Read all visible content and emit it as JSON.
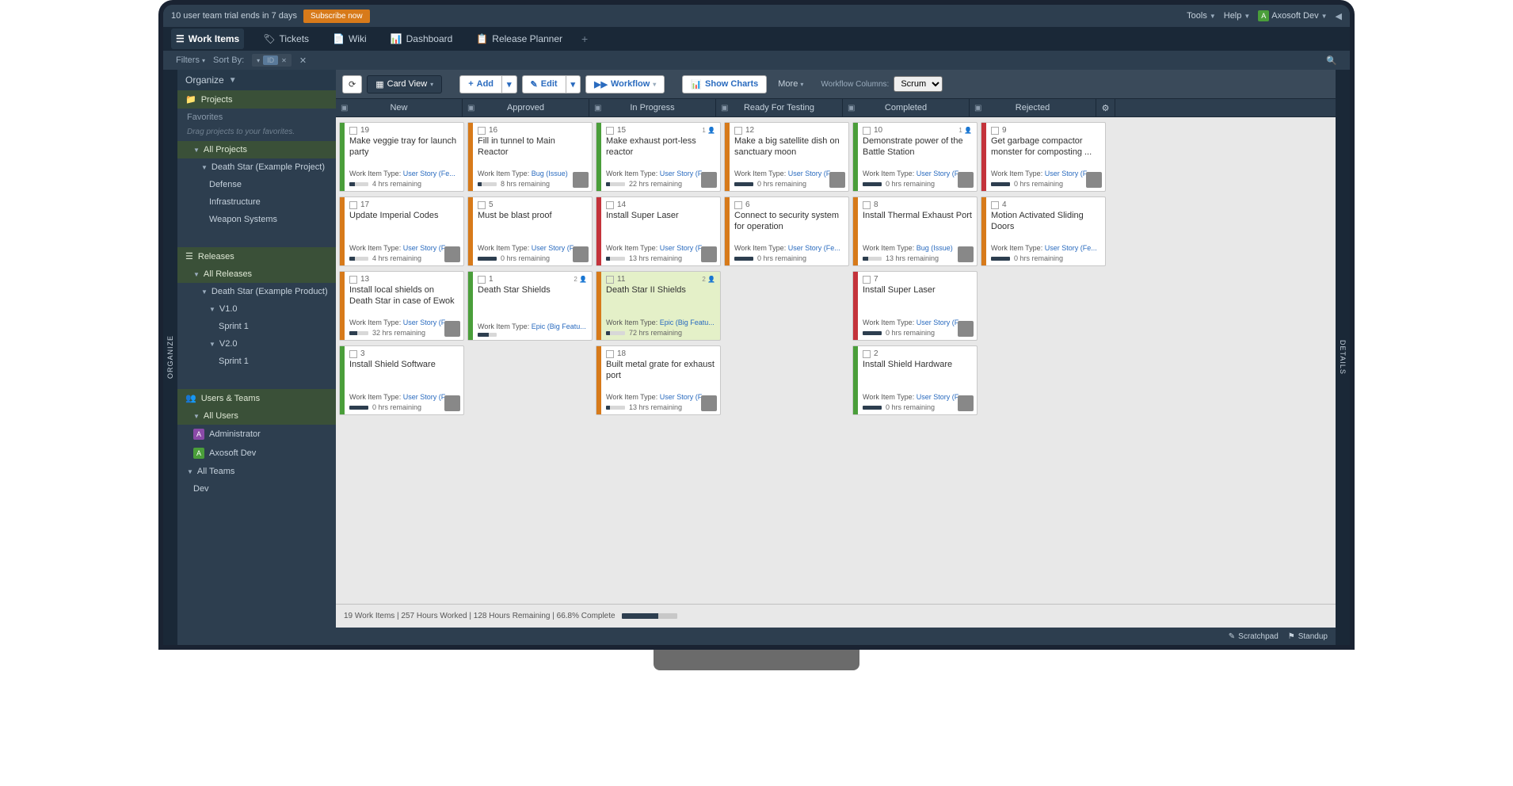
{
  "topbar": {
    "trial_msg": "10 user team trial ends in 7 days",
    "subscribe": "Subscribe now",
    "tools": "Tools",
    "help": "Help",
    "user": "Axosoft Dev",
    "user_initial": "A"
  },
  "tabs": {
    "work_items": "Work Items",
    "tickets": "Tickets",
    "wiki": "Wiki",
    "dashboard": "Dashboard",
    "release_planner": "Release Planner"
  },
  "filterbar": {
    "filters": "Filters",
    "sort_by": "Sort By:",
    "sort_chip": "ID"
  },
  "sidebar": {
    "organize": "Organize",
    "projects": "Projects",
    "favorites": "Favorites",
    "fav_hint": "Drag projects to your favorites.",
    "all_projects": "All Projects",
    "project_tree": {
      "name": "Death Star (Example Project)",
      "children": [
        "Defense",
        "Infrastructure",
        "Weapon Systems"
      ]
    },
    "releases": "Releases",
    "all_releases": "All Releases",
    "release_tree": {
      "name": "Death Star (Example Product)",
      "v1": "V1.0",
      "sprint1": "Sprint 1",
      "v2": "V2.0",
      "sprint1b": "Sprint 1"
    },
    "users_teams": "Users & Teams",
    "all_users": "All Users",
    "admin": "Administrator",
    "axdev": "Axosoft Dev",
    "all_teams": "All Teams",
    "dev": "Dev"
  },
  "toolbar": {
    "card_view": "Card View",
    "add": "Add",
    "edit": "Edit",
    "workflow": "Workflow",
    "show_charts": "Show Charts",
    "more": "More",
    "workflow_columns": "Workflow Columns:",
    "scrum": "Scrum"
  },
  "columns": [
    "New",
    "Approved",
    "In Progress",
    "Ready For Testing",
    "Completed",
    "Rejected"
  ],
  "cards": [
    [
      {
        "id": "19",
        "title": "Make veggie tray for launch party",
        "type": "User Story (Fe...",
        "remaining": "4 hrs remaining",
        "stripe": "green",
        "progress": 30
      },
      {
        "id": "17",
        "title": "Update Imperial Codes",
        "type": "User Story (Fe...",
        "remaining": "4 hrs remaining",
        "stripe": "orange",
        "progress": 30,
        "avatar": true
      },
      {
        "id": "13",
        "title": "Install local shields on Death Star in case of Ewok uprising",
        "type": "User Story (Fe...",
        "remaining": "32 hrs remaining",
        "stripe": "orange",
        "progress": 40,
        "avatar": true
      },
      {
        "id": "3",
        "title": "Install Shield Software",
        "type": "User Story (Fe...",
        "remaining": "0 hrs remaining",
        "stripe": "green",
        "progress": 100,
        "avatar": true
      }
    ],
    [
      {
        "id": "16",
        "title": "Fill in tunnel to Main Reactor",
        "type": "Bug (Issue)",
        "remaining": "8 hrs remaining",
        "stripe": "orange",
        "progress": 20,
        "avatar": true
      },
      {
        "id": "5",
        "title": "Must be blast proof",
        "type": "User Story (Fe...",
        "remaining": "0 hrs remaining",
        "stripe": "orange",
        "progress": 100,
        "avatar": true
      },
      {
        "id": "1",
        "title": "Death Star Shields",
        "type": "Epic (Big Featu...",
        "remaining": "",
        "stripe": "green",
        "progress": 60,
        "badge": "2"
      }
    ],
    [
      {
        "id": "15",
        "title": "Make exhaust port-less reactor",
        "type": "User Story (Fe...",
        "remaining": "22 hrs remaining",
        "stripe": "green",
        "progress": 20,
        "avatar": true,
        "badge": "1"
      },
      {
        "id": "14",
        "title": "Install Super Laser",
        "type": "User Story (Fe...",
        "remaining": "13 hrs remaining",
        "stripe": "red",
        "progress": 20,
        "avatar": true
      },
      {
        "id": "11",
        "title": "Death Star II Shields",
        "type": "Epic (Big Featu...",
        "remaining": "72 hrs remaining",
        "stripe": "orange",
        "progress": 20,
        "highlighted": true,
        "badge": "2"
      },
      {
        "id": "18",
        "title": "Built metal grate for exhaust port",
        "type": "User Story (Fe...",
        "remaining": "13 hrs remaining",
        "stripe": "orange",
        "progress": 20,
        "avatar": true
      }
    ],
    [
      {
        "id": "12",
        "title": "Make a big satellite dish on sanctuary moon",
        "type": "User Story (Fe...",
        "remaining": "0 hrs remaining",
        "stripe": "orange",
        "progress": 100,
        "avatar": true
      },
      {
        "id": "6",
        "title": "Connect to security system for operation",
        "type": "User Story (Fe...",
        "remaining": "0 hrs remaining",
        "stripe": "orange",
        "progress": 100
      }
    ],
    [
      {
        "id": "10",
        "title": "Demonstrate power of the Battle Station",
        "type": "User Story (Fe...",
        "remaining": "0 hrs remaining",
        "stripe": "green",
        "progress": 100,
        "avatar": true,
        "badge": "1"
      },
      {
        "id": "8",
        "title": "Install Thermal Exhaust Port",
        "type": "Bug (Issue)",
        "remaining": "13 hrs remaining",
        "stripe": "orange",
        "progress": 30,
        "avatar": true
      },
      {
        "id": "7",
        "title": "Install Super Laser",
        "type": "User Story (Fe...",
        "remaining": "0 hrs remaining",
        "stripe": "red",
        "progress": 100,
        "avatar": true
      },
      {
        "id": "2",
        "title": "Install Shield Hardware",
        "type": "User Story (Fe...",
        "remaining": "0 hrs remaining",
        "stripe": "green",
        "progress": 100,
        "avatar": true
      }
    ],
    [
      {
        "id": "9",
        "title": "Get garbage compactor monster for composting ...",
        "type": "User Story (Fe...",
        "remaining": "0 hrs remaining",
        "stripe": "red",
        "progress": 100,
        "avatar": true
      },
      {
        "id": "4",
        "title": "Motion Activated Sliding Doors",
        "type": "User Story (Fe...",
        "remaining": "0 hrs remaining",
        "stripe": "orange",
        "progress": 100
      }
    ]
  ],
  "status": {
    "text": "19 Work Items | 257 Hours Worked | 128 Hours Remaining | 66.8% Complete",
    "percent": 66.8
  },
  "footer": {
    "scratchpad": "Scratchpad",
    "standup": "Standup"
  },
  "labels": {
    "work_item_type": "Work Item Type:"
  }
}
